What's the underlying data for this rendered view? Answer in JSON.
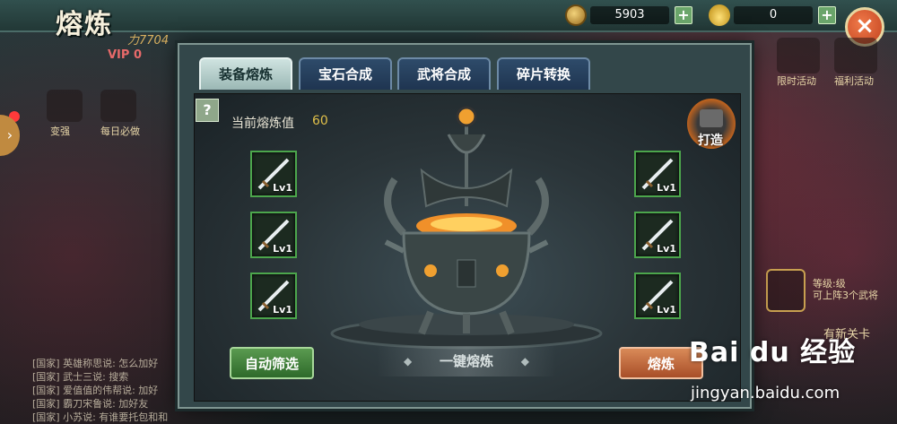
{
  "header": {
    "title": "熔炼",
    "power": "力7704",
    "vip": "VIP 0",
    "coins": "5903",
    "ingots": "0",
    "plus": "+",
    "close": "×"
  },
  "side": {
    "left_items": [
      "变强",
      "每日必做"
    ],
    "right_items": [
      "限时活动",
      "福利活动"
    ],
    "right_badge": "等级:级\n可上阵3个武将",
    "right_bottom": "有新关卡"
  },
  "chat": [
    "[国家] 英雄称思说: 怎么加好",
    "[国家] 武士三说: 搜索",
    "[国家] 爱值值的伟帮说: 加好",
    "[国家] 霸刀宋鲁说: 加好友",
    "[国家] 小苏说: 有谁要托包和和"
  ],
  "tabs": [
    {
      "label": "装备熔炼",
      "active": true
    },
    {
      "label": "宝石合成",
      "active": false
    },
    {
      "label": "武将合成",
      "active": false
    },
    {
      "label": "碎片转换",
      "active": false
    }
  ],
  "smelt": {
    "help": "?",
    "value_label": "当前熔炼值",
    "value": "60",
    "forge_label": "打造",
    "slot_level": "Lv1",
    "auto_filter": "自动筛选",
    "one_click": "一键熔炼",
    "smelt": "熔炼"
  },
  "watermark": {
    "main": "Bai du 经验",
    "sub": "jingyan.baidu.com"
  },
  "colors": {
    "slot_border": "#4ca64c",
    "value_color": "#e0c04a"
  }
}
